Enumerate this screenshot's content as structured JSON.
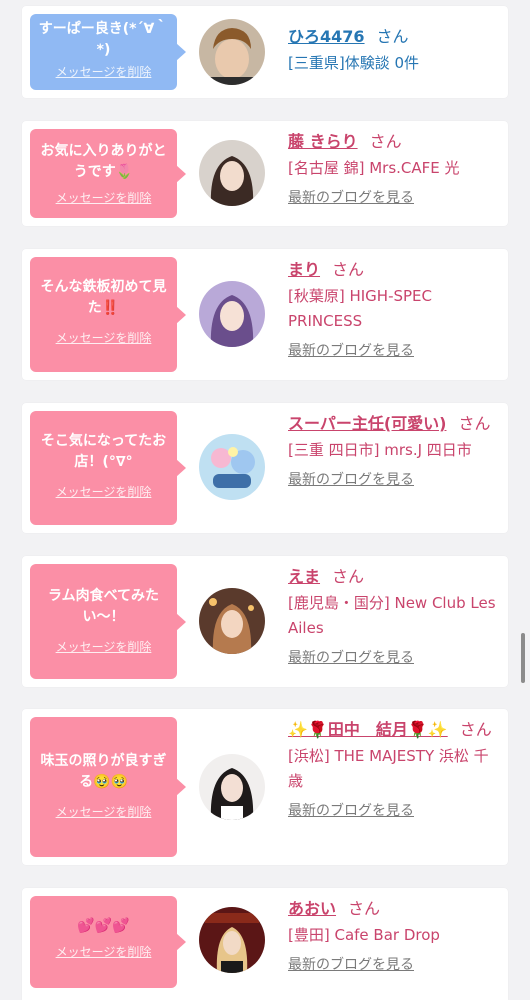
{
  "colors": {
    "bubble_blue": "#90b9f3",
    "bubble_pink": "#fb8fa6",
    "name_blue": "#2676b3",
    "name_pink": "#c9446c",
    "blog_link": "#7a7a7a",
    "card_bg": "#ffffff",
    "page_bg": "#f2f2f4"
  },
  "entries": [
    {
      "message": "すーぱー良き(*´∀｀*)",
      "delete_label": "メッセージを削除",
      "avatar_icon": "avatar-photo-user",
      "name": "ひろ4476",
      "suffix": "さん",
      "shop": "[三重県]体験談 0件",
      "blog_label": ""
    },
    {
      "message": "お気に入りありがとうです🌷",
      "delete_label": "メッセージを削除",
      "avatar_icon": "avatar-photo-girl",
      "name": "藤 きらり",
      "suffix": "さん",
      "shop": "[名古屋 錦] Mrs.CAFE 光",
      "blog_label": "最新のブログを見る"
    },
    {
      "message": "そんな鉄板初めて見た‼️",
      "delete_label": "メッセージを削除",
      "avatar_icon": "avatar-photo-girl",
      "name": "まり",
      "suffix": "さん",
      "shop": "[秋葉原] HIGH-SPEC PRINCESS",
      "blog_label": "最新のブログを見る"
    },
    {
      "message": "そこ気になってたお店！(°∇°",
      "delete_label": "メッセージを削除",
      "avatar_icon": "avatar-photo-illustration",
      "name": "スーパー主任(可愛い)",
      "suffix": "さん",
      "shop": "[三重 四日市] mrs.J 四日市",
      "blog_label": "最新のブログを見る"
    },
    {
      "message": "ラム肉食べてみたい〜！",
      "delete_label": "メッセージを削除",
      "avatar_icon": "avatar-photo-girl",
      "name": "えま",
      "suffix": "さん",
      "shop": "[鹿児島・国分] New Club Les Ailes",
      "blog_label": "最新のブログを見る"
    },
    {
      "message": "味玉の照りが良すぎる🥹🥹",
      "delete_label": "メッセージを削除",
      "avatar_icon": "avatar-photo-girl",
      "name": "✨🌹田中　結月🌹✨",
      "suffix": "さん",
      "shop": "[浜松] THE MAJESTY 浜松 千歳",
      "blog_label": "最新のブログを見る"
    },
    {
      "message": "💕💕💕",
      "delete_label": "メッセージを削除",
      "avatar_icon": "avatar-photo-girl",
      "name": "あおい",
      "suffix": "さん",
      "shop": "[豊田] Cafe Bar Drop",
      "blog_label": "最新のブログを見る"
    }
  ]
}
